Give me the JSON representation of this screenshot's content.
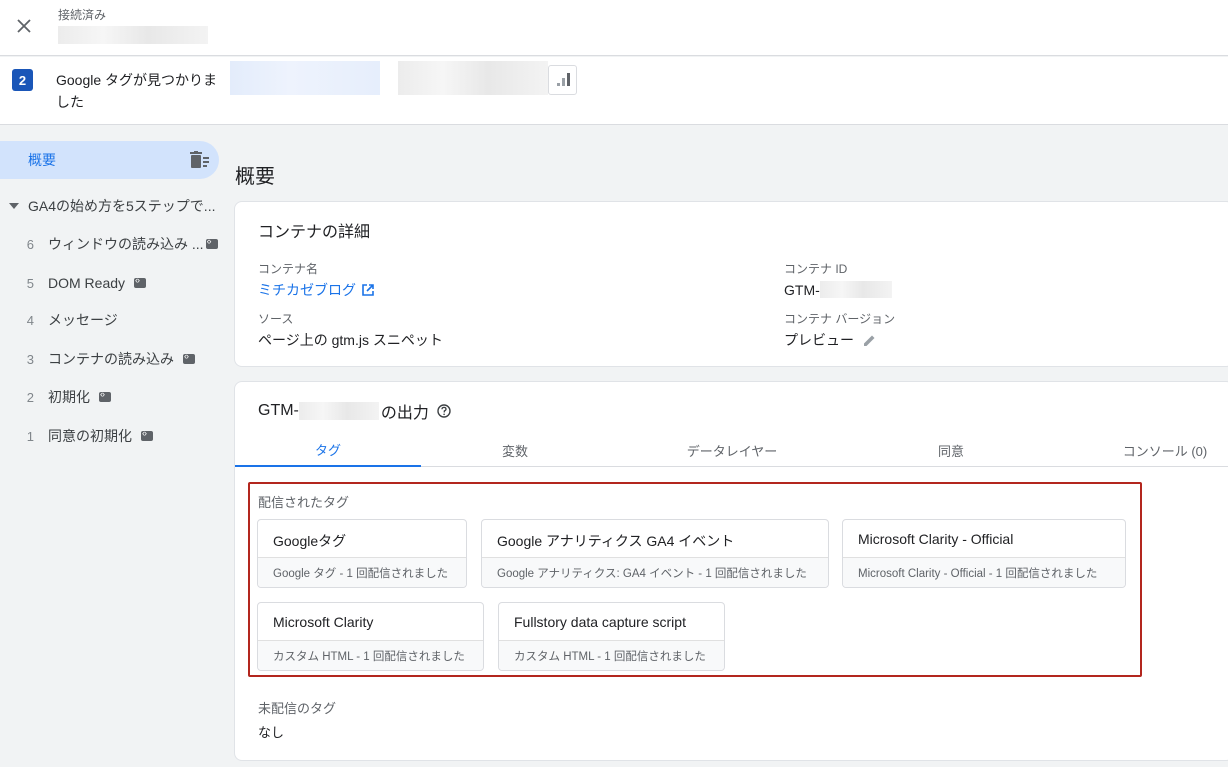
{
  "topbar": {
    "connected_label": "接続済み"
  },
  "summary": {
    "badge": "2",
    "title": "Google タグが見つかりました"
  },
  "sidebar": {
    "overview_label": "概要",
    "container_label": "GA4の始め方を5ステップで...",
    "events": [
      {
        "num": "6",
        "label": "ウィンドウの読み込み ...",
        "has_code_icon": true
      },
      {
        "num": "5",
        "label": "DOM Ready",
        "has_code_icon": true
      },
      {
        "num": "4",
        "label": "メッセージ",
        "has_code_icon": false
      },
      {
        "num": "3",
        "label": "コンテナの読み込み",
        "has_code_icon": true
      },
      {
        "num": "2",
        "label": "初期化",
        "has_code_icon": true
      },
      {
        "num": "1",
        "label": "同意の初期化",
        "has_code_icon": true
      }
    ]
  },
  "main": {
    "title": "概要",
    "details": {
      "title": "コンテナの詳細",
      "name_label": "コンテナ名",
      "name_value": "ミチカゼブログ",
      "id_label": "コンテナ ID",
      "id_value": "GTM-",
      "source_label": "ソース",
      "source_value": "ページ上の gtm.js スニペット",
      "version_label": "コンテナ バージョン",
      "version_value": "プレビュー"
    },
    "output": {
      "title_prefix": "GTM-",
      "title_suffix": "の出力",
      "tabs": [
        "タグ",
        "変数",
        "データレイヤー",
        "同意",
        "コンソール (0)"
      ],
      "active_tab": 0,
      "fired_label": "配信されたタグ",
      "fired_tags": [
        {
          "name": "Googleタグ",
          "sub": "Google タグ - 1 回配信されました"
        },
        {
          "name": "Google アナリティクス GA4 イベント",
          "sub": "Google アナリティクス: GA4 イベント - 1 回配信されました"
        },
        {
          "name": "Microsoft Clarity - Official",
          "sub": "Microsoft Clarity - Official - 1 回配信されました"
        },
        {
          "name": "Microsoft Clarity",
          "sub": "カスタム HTML - 1 回配信されました"
        },
        {
          "name": "Fullstory data capture script",
          "sub": "カスタム HTML - 1 回配信されました"
        }
      ],
      "not_fired_label": "未配信のタグ",
      "not_fired_value": "なし"
    }
  },
  "colors": {
    "accent": "#1a73e8",
    "badge": "#1a56b8",
    "highlight_border": "#b3261e",
    "selected_bg": "#d2e3fc"
  }
}
